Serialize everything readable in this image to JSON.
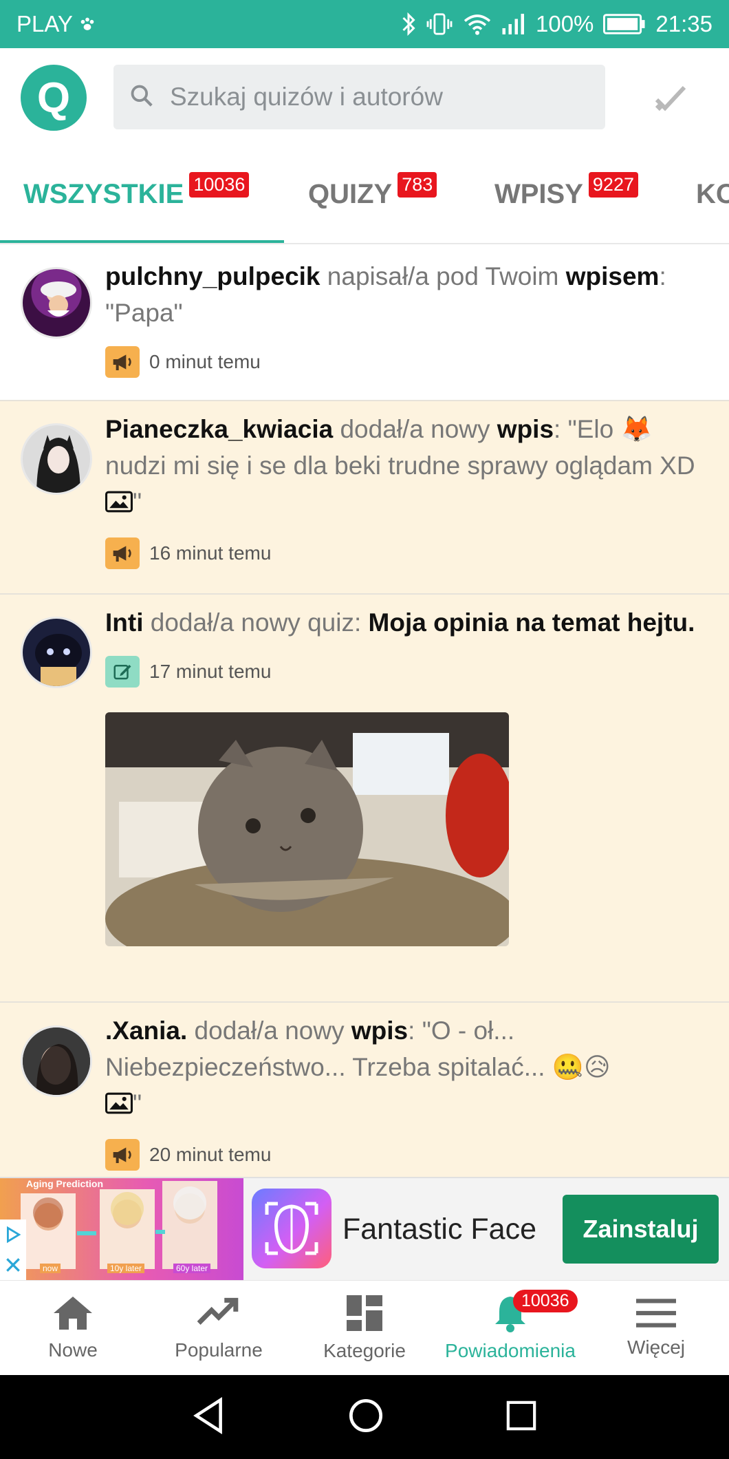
{
  "status_bar": {
    "carrier": "PLAY",
    "battery": "100%",
    "time": "21:35"
  },
  "app_bar": {
    "logo_letter": "Q",
    "search_placeholder": "Szukaj quizów i autorów"
  },
  "tabs": [
    {
      "label": "WSZYSTKIE",
      "badge": "10036",
      "active": true
    },
    {
      "label": "QUIZY",
      "badge": "783",
      "active": false
    },
    {
      "label": "WPISY",
      "badge": "9227",
      "active": false
    },
    {
      "label": "KO",
      "badge": "",
      "active": false
    }
  ],
  "feed": [
    {
      "user": "pulchny_pulpecik",
      "action": " napisał/a pod Twoim ",
      "target": "wpisem",
      "text": ": \"Papa\"",
      "time": "0 minut temu",
      "icon": "megaphone-icon"
    },
    {
      "user": "Pianeczka_kwiacia",
      "action": " dodał/a nowy ",
      "target": "wpis",
      "text": ": \"Elo ",
      "text2": " nudzi mi się i se dla beki trudne sprawy oglądam XD ",
      "text3": "\"",
      "emoji": "🦊",
      "time": "16 minut temu",
      "icon": "megaphone-icon"
    },
    {
      "user": "Inti",
      "action": " dodał/a nowy quiz: ",
      "target": "Moja opinia na temat hejtu.",
      "time": "17 minut temu",
      "icon": "edit-icon"
    },
    {
      "user": ".Xania.",
      "action": " dodał/a nowy ",
      "target": "wpis",
      "text": ": \"O - oł... Niebezpieczeństwo... Trzeba spitalać... ",
      "emoji": "🤐😥",
      "text3": "\"",
      "time": "20 minut temu",
      "icon": "megaphone-icon"
    }
  ],
  "ad": {
    "image_caption": "Aging Prediction",
    "labels": [
      "now",
      "10y later",
      "60y later"
    ],
    "title": "Fantastic Face",
    "install": "Zainstaluj"
  },
  "bottom_nav": [
    {
      "label": "Nowe",
      "icon": "home-icon"
    },
    {
      "label": "Popularne",
      "icon": "trending-icon"
    },
    {
      "label": "Kategorie",
      "icon": "grid-icon"
    },
    {
      "label": "Powiadomienia",
      "icon": "bell-icon",
      "badge": "10036",
      "active": true
    },
    {
      "label": "Więcej",
      "icon": "menu-icon"
    }
  ],
  "colors": {
    "accent": "#2bb39a",
    "badge": "#e8161e",
    "cream": "#fdf3df",
    "install": "#148f5d"
  }
}
